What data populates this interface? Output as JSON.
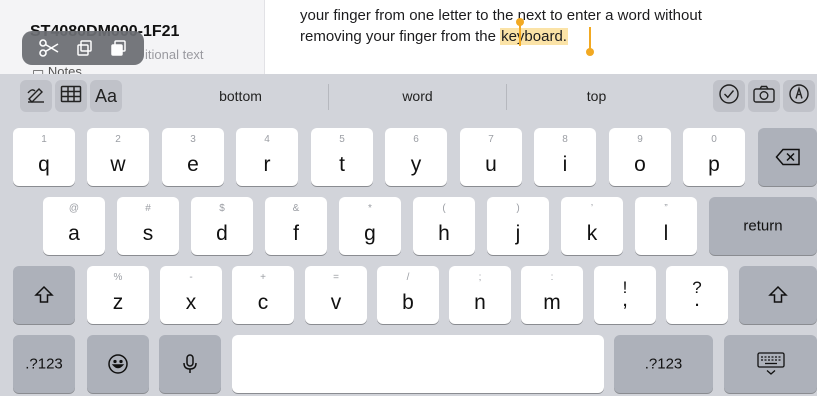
{
  "note": {
    "title": "ST4080DM000-1F21",
    "subtitle": "itional text",
    "folder": "Notes",
    "body_line1": "your finger from one letter to the next to enter a word without",
    "body_line2_before": "removing your finger from the ",
    "body_selected": "keyboard.",
    "edit_menu_icons": [
      "scissors-icon",
      "copy-icon",
      "paste-icon"
    ]
  },
  "suggestion_bar": {
    "left_icons": [
      "scribble-icon",
      "table-icon"
    ],
    "format_label": "Aa",
    "suggestions": [
      "bottom",
      "word",
      "top"
    ],
    "right_icons": [
      "checklist-icon",
      "camera-icon",
      "markup-icon"
    ]
  },
  "keyboard": {
    "row1": [
      {
        "hint": "1",
        "main": "q"
      },
      {
        "hint": "2",
        "main": "w"
      },
      {
        "hint": "3",
        "main": "e"
      },
      {
        "hint": "4",
        "main": "r"
      },
      {
        "hint": "5",
        "main": "t"
      },
      {
        "hint": "6",
        "main": "y"
      },
      {
        "hint": "7",
        "main": "u"
      },
      {
        "hint": "8",
        "main": "i"
      },
      {
        "hint": "9",
        "main": "o"
      },
      {
        "hint": "0",
        "main": "p"
      }
    ],
    "row2": [
      {
        "hint": "@",
        "main": "a"
      },
      {
        "hint": "#",
        "main": "s"
      },
      {
        "hint": "$",
        "main": "d"
      },
      {
        "hint": "&",
        "main": "f"
      },
      {
        "hint": "*",
        "main": "g"
      },
      {
        "hint": "(",
        "main": "h"
      },
      {
        "hint": ")",
        "main": "j"
      },
      {
        "hint": "’",
        "main": "k"
      },
      {
        "hint": "”",
        "main": "l"
      }
    ],
    "row3": [
      {
        "hint": "%",
        "main": "z"
      },
      {
        "hint": "-",
        "main": "x"
      },
      {
        "hint": "+",
        "main": "c"
      },
      {
        "hint": "=",
        "main": "v"
      },
      {
        "hint": "/",
        "main": "b"
      },
      {
        "hint": ";",
        "main": "n"
      },
      {
        "hint": ":",
        "main": "m"
      },
      {
        "hint": "!",
        "main": ","
      },
      {
        "hint": "?",
        "main": "."
      }
    ],
    "return_label": "return",
    "numbers_label": ".?123",
    "numbers_label_right": ".?123"
  }
}
